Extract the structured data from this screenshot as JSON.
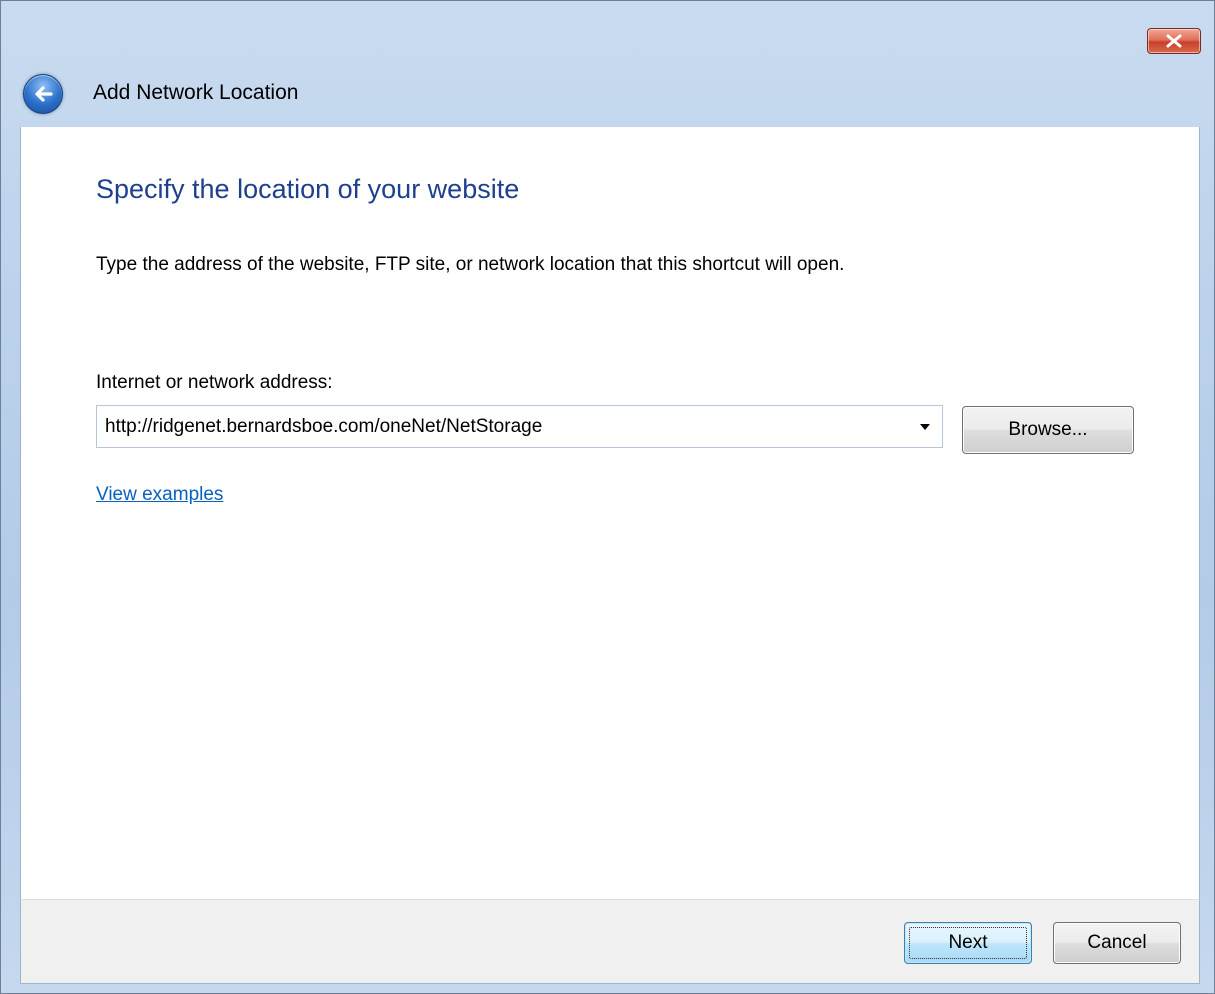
{
  "window": {
    "title": "Add Network Location",
    "close_icon": "close-icon",
    "back_icon": "back-arrow-icon"
  },
  "page": {
    "heading": "Specify the location of your website",
    "instruction": "Type the address of the website, FTP site, or network location that this shortcut will open.",
    "address": {
      "label": "Internet or network address:",
      "value": "http://ridgenet.bernardsboe.com/oneNet/NetStorage",
      "dropdown_icon": "chevron-down-icon"
    },
    "browse_label": "Browse...",
    "view_examples_label": "View examples"
  },
  "footer": {
    "next_label": "Next",
    "cancel_label": "Cancel"
  },
  "colors": {
    "heading": "#1e3f8e",
    "link": "#0a5fbf",
    "close_button": "#c9402a",
    "frame": "#bcd2ec"
  }
}
